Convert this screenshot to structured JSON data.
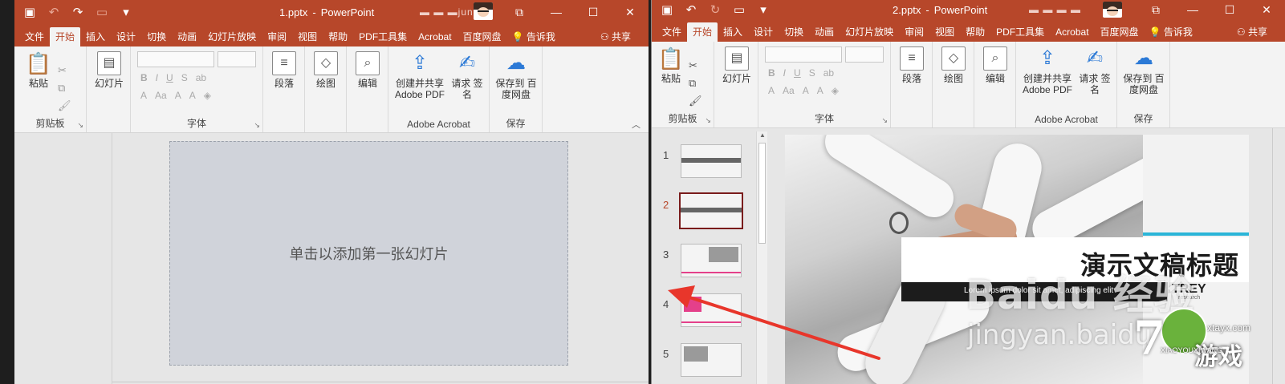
{
  "window1": {
    "doc_name": "1.pptx",
    "sep": "-",
    "app_name": "PowerPoint",
    "user": "jun",
    "tabs": [
      "文件",
      "开始",
      "插入",
      "设计",
      "切换",
      "动画",
      "幻灯片放映",
      "审阅",
      "视图",
      "帮助",
      "PDF工具集",
      "Acrobat",
      "百度网盘"
    ],
    "active_tab": "开始",
    "tell_me": "告诉我",
    "share": "共享",
    "groups": {
      "clipboard": "剪贴板",
      "paste": "粘贴",
      "slides_btn": "幻灯片",
      "font": "字体",
      "paragraph": "段落",
      "drawing": "绘图",
      "editing": "编辑",
      "create_share_pdf": "创建并共享 Adobe PDF",
      "request_sign": "请求 签名",
      "adobe_acrobat": "Adobe Acrobat",
      "save_to_baidu": "保存到 百度网盘",
      "save": "保存"
    },
    "placeholder": "单击以添加第一张幻灯片"
  },
  "window2": {
    "doc_name": "2.pptx",
    "sep": "-",
    "app_name": "PowerPoint",
    "tabs": [
      "文件",
      "开始",
      "插入",
      "设计",
      "切换",
      "动画",
      "幻灯片放映",
      "审阅",
      "视图",
      "帮助",
      "PDF工具集",
      "Acrobat",
      "百度网盘"
    ],
    "active_tab": "开始",
    "tell_me": "告诉我",
    "share": "共享",
    "groups": {
      "clipboard": "剪贴板",
      "paste": "粘贴",
      "slides_btn": "幻灯片",
      "font": "字体",
      "paragraph": "段落",
      "drawing": "绘图",
      "editing": "编辑",
      "create_share_pdf": "创建并共享 Adobe PDF",
      "request_sign": "请求 签名",
      "adobe_acrobat": "Adobe Acrobat",
      "save_to_baidu": "保存到 百度网盘",
      "save": "保存"
    },
    "thumbnails": [
      "1",
      "2",
      "3",
      "4",
      "5"
    ],
    "current_slide": "2",
    "slide": {
      "title": "演示文稿标题",
      "subtitle": "Lorem ipsum dolor sit amet, adipiscing elit",
      "logo": "TREY",
      "logo_sub": "research"
    }
  },
  "overlays": {
    "watermark_brand": "Bai",
    "watermark_brand2": "经验",
    "watermark_url": "jingyan.baidu",
    "badge_url": "xtayx.com",
    "badge_cn": "游戏",
    "badge_py": "XIAOYOUXIWANG"
  },
  "colors": {
    "ppt_red": "#b7472a",
    "arrow_red": "#e8362b",
    "accent_teal": "#2bb5d8"
  }
}
